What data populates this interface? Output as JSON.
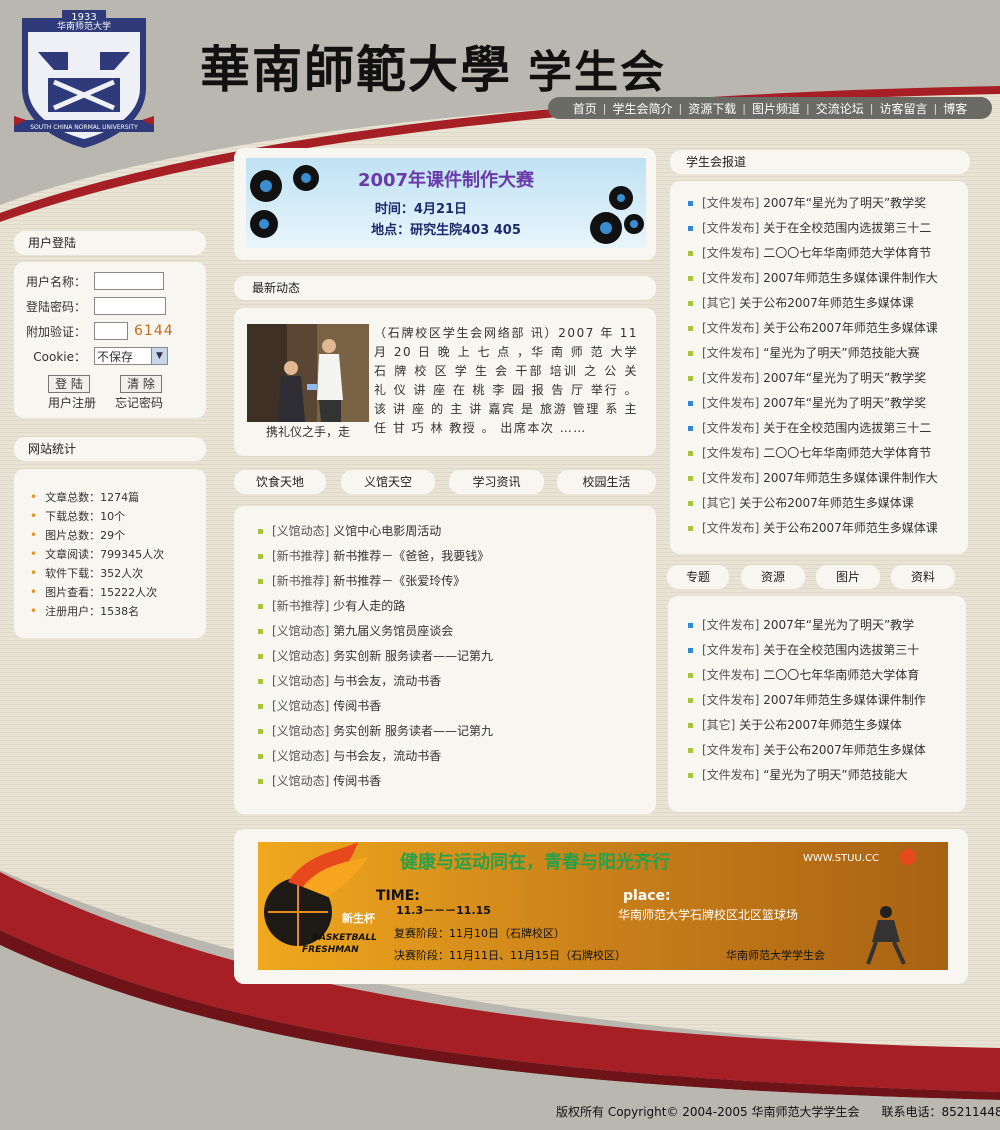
{
  "header": {
    "title": "華南師範大學",
    "subtitle": "学生会",
    "logo_year": "1933",
    "logo_name": "华南师范大学",
    "logo_en": "SOUTH CHINA NORMAL UNIVERSITY"
  },
  "nav": [
    "首页",
    "学生会简介",
    "资源下载",
    "图片频道",
    "交流论坛",
    "访客留言",
    "博客"
  ],
  "login": {
    "title": "用户登陆",
    "username_label": "用户名称：",
    "password_label": "登陆密码：",
    "verify_label": "附加验证：",
    "verify_code": "6144",
    "cookie_label": "Cookie：",
    "cookie_value": "不保存",
    "login_button": "登 陆",
    "clear_button": "清 除",
    "register_link": "用户注册",
    "forgot_link": "忘记密码"
  },
  "stats": {
    "title": "网站统计",
    "items": [
      "文章总数：1274篇",
      "下载总数：10个",
      "图片总数：29个",
      "文章阅读：799345人次",
      "软件下载：352人次",
      "图片查看：15222人次",
      "注册用户：1538名"
    ]
  },
  "banner1": {
    "title": "2007年课件制作大赛",
    "time": "时间：4月21日",
    "place": "地点：研究生院403 405"
  },
  "latest": {
    "title": "最新动态",
    "photo_caption": "携礼仪之手，走",
    "text": "（石牌校区学生会网络部 讯）2007 年 11 月 20 日 晚 上 七 点 ，华 南 师 范 大学 石 牌 校 区 学 生 会 干部 培训 之 公 关 礼 仪 讲 座 在 桃 李 园 报 告 厅 举行 。 该 讲 座 的 主 讲 嘉宾 是 旅游 管理 系 主 任 甘 巧 林 教授 。 出席本次 ……"
  },
  "mid_tabs": [
    "饮食天地",
    "义馆天空",
    "学习资讯",
    "校园生活"
  ],
  "mid_list": [
    {
      "cat": "[义馆动态]",
      "text": "义馆中心电影周活动"
    },
    {
      "cat": "[新书推荐]",
      "text": "新书推荐－《爸爸，我要钱》"
    },
    {
      "cat": "[新书推荐]",
      "text": "新书推荐－《张爱玲传》"
    },
    {
      "cat": "[新书推荐]",
      "text": "少有人走的路"
    },
    {
      "cat": "[义馆动态]",
      "text": "第九届义务馆员座谈会"
    },
    {
      "cat": "[义馆动态]",
      "text": "务实创新 服务读者——记第九"
    },
    {
      "cat": "[义馆动态]",
      "text": "与书会友，流动书香"
    },
    {
      "cat": "[义馆动态]",
      "text": "传阅书香"
    },
    {
      "cat": "[义馆动态]",
      "text": "务实创新 服务读者——记第九"
    },
    {
      "cat": "[义馆动态]",
      "text": "与书会友，流动书香"
    },
    {
      "cat": "[义馆动态]",
      "text": "传阅书香"
    }
  ],
  "report": {
    "title": "学生会报道",
    "items": [
      {
        "cat": "[文件发布]",
        "text": "2007年“星光为了明天”教学奖",
        "color": "#2d8ad8"
      },
      {
        "cat": "[文件发布]",
        "text": "关于在全校范围内选拔第三十二",
        "color": "#2d8ad8"
      },
      {
        "cat": "[文件发布]",
        "text": "二〇〇七年华南师范大学体育节",
        "color": "#a8c43a"
      },
      {
        "cat": "[文件发布]",
        "text": "2007年师范生多媒体课件制作大",
        "color": "#a8c43a"
      },
      {
        "cat": "[其它]",
        "text": "关于公布2007年师范生多媒体课",
        "color": "#a8c43a"
      },
      {
        "cat": "[文件发布]",
        "text": "关于公布2007年师范生多媒体课",
        "color": "#a8c43a"
      },
      {
        "cat": "[文件发布]",
        "text": "“星光为了明天”师范技能大赛",
        "color": "#a8c43a"
      },
      {
        "cat": "[文件发布]",
        "text": "2007年“星光为了明天”教学奖",
        "color": "#a8c43a"
      },
      {
        "cat": "[文件发布]",
        "text": "2007年“星光为了明天”教学奖",
        "color": "#2d8ad8"
      },
      {
        "cat": "[文件发布]",
        "text": "关于在全校范围内选拔第三十二",
        "color": "#2d8ad8"
      },
      {
        "cat": "[文件发布]",
        "text": "二〇〇七年华南师范大学体育节",
        "color": "#a8c43a"
      },
      {
        "cat": "[文件发布]",
        "text": "2007年师范生多媒体课件制作大",
        "color": "#a8c43a"
      },
      {
        "cat": "[其它]",
        "text": "关于公布2007年师范生多媒体课",
        "color": "#a8c43a"
      },
      {
        "cat": "[文件发布]",
        "text": "关于公布2007年师范生多媒体课",
        "color": "#a8c43a"
      }
    ]
  },
  "right_tabs": [
    "专题",
    "资源",
    "图片",
    "资料"
  ],
  "right_list": [
    {
      "cat": "[文件发布]",
      "text": "2007年“星光为了明天”教学",
      "color": "#2d8ad8"
    },
    {
      "cat": "[文件发布]",
      "text": "关于在全校范围内选拔第三十",
      "color": "#2d8ad8"
    },
    {
      "cat": "[文件发布]",
      "text": "二〇〇七年华南师范大学体育",
      "color": "#a8c43a"
    },
    {
      "cat": "[文件发布]",
      "text": "2007年师范生多媒体课件制作",
      "color": "#a8c43a"
    },
    {
      "cat": "[其它]",
      "text": "关于公布2007年师范生多媒体",
      "color": "#a8c43a"
    },
    {
      "cat": "[文件发布]",
      "text": "关于公布2007年师范生多媒体",
      "color": "#a8c43a"
    },
    {
      "cat": "[文件发布]",
      "text": "“星光为了明天”师范技能大",
      "color": "#a8c43a"
    }
  ],
  "banner2": {
    "slogan": "健康与运动同在，青春与阳光齐行",
    "site": "WWW.STUU.CC",
    "time_label": "TIME:",
    "time_value": "11.3－－－11.15",
    "place_label": "place:",
    "place_value": "华南师范大学石牌校区北区篮球场",
    "cup": "新生杯",
    "en1": "BASKETBALL",
    "en2": "FRESHMAN",
    "stage1": "复赛阶段：11月10日（石牌校区）",
    "stage2": "决赛阶段：11月11日、11月15日（石牌校区）",
    "org": "华南师范大学学生会"
  },
  "footer": {
    "copyright": "版权所有 Copyright© 2004-2005 华南师范大学学生会",
    "phone": "联系电话：85211448"
  },
  "colors": {
    "accent_red": "#a51f24",
    "panel": "#f7f6f0",
    "bg_gray": "#b9b7b0"
  }
}
